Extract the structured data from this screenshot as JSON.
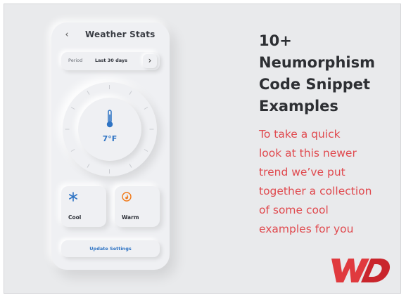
{
  "phone": {
    "title": "Weather Stats",
    "back_icon": "chevron-left-icon",
    "period_label": "Period",
    "period_value": "Last 30 days",
    "period_next_icon": "chevron-right-icon",
    "temperature": "7°F",
    "thermometer_icon": "thermometer-icon",
    "tiles": [
      {
        "label": "Cool",
        "icon": "snowflake-icon",
        "color": "#2f74c4"
      },
      {
        "label": "Warm",
        "icon": "flame-icon",
        "color": "#f07a1a"
      }
    ],
    "update_button": "Update Settings"
  },
  "article": {
    "headline_lines": [
      "10+",
      "Neumorphism",
      "Code Snippet",
      "Examples"
    ],
    "description_lines": [
      "To take a quick",
      "look at this newer",
      "trend we’ve put",
      "together a collection",
      "of some cool",
      "examples for you"
    ]
  },
  "logo": {
    "text": "WD",
    "color": "#e03a3e"
  },
  "colors": {
    "accent_blue": "#2f74c4",
    "accent_red": "#e04a4f",
    "background": "#e9eaec"
  }
}
